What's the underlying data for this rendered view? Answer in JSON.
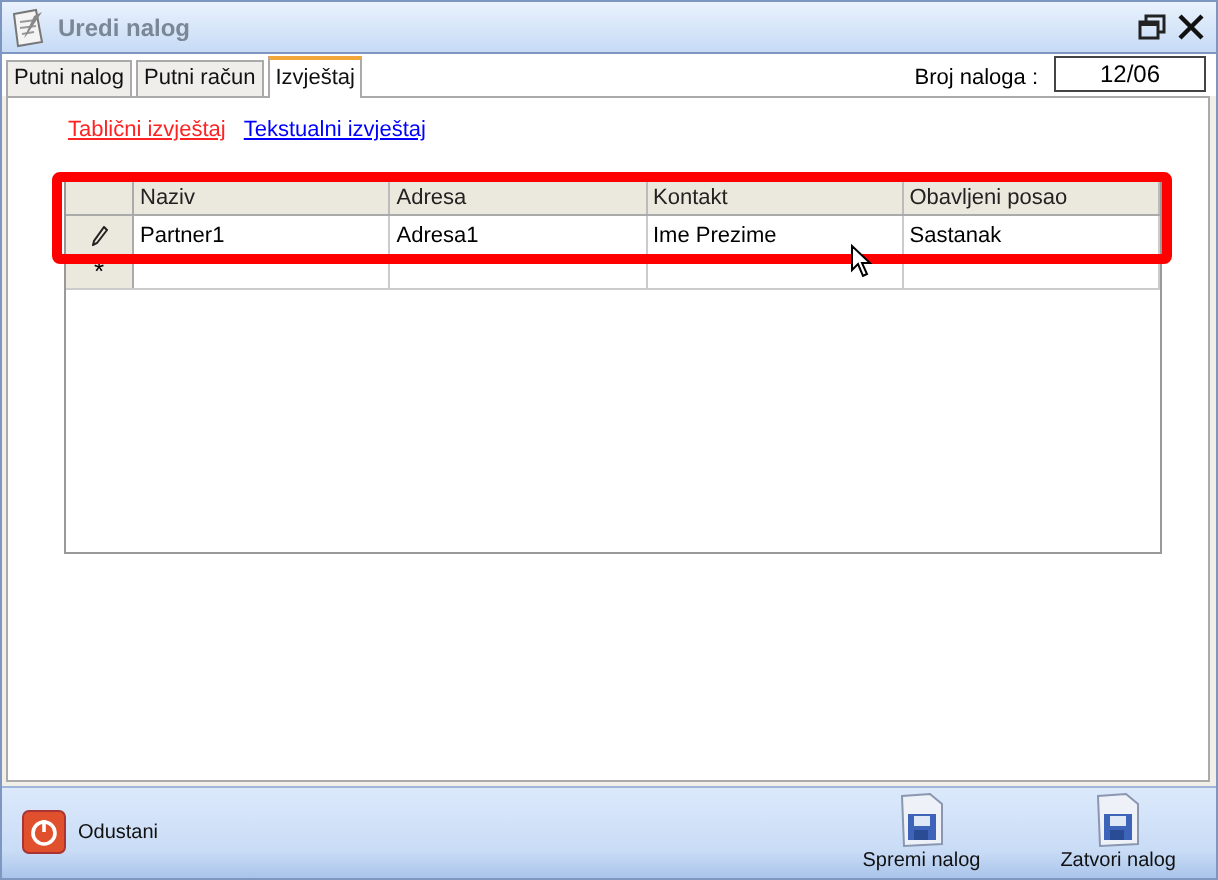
{
  "window": {
    "title": "Uredi nalog"
  },
  "tabs": [
    {
      "label": "Putni nalog",
      "selected": false
    },
    {
      "label": "Putni račun",
      "selected": false
    },
    {
      "label": "Izvještaj",
      "selected": true
    }
  ],
  "order_number": {
    "label": "Broj naloga :",
    "value": "12/06"
  },
  "report_links": [
    {
      "label": "Tablični izvještaj",
      "selected": true
    },
    {
      "label": "Tekstualni izvještaj",
      "selected": false
    }
  ],
  "table": {
    "columns": [
      "Naziv",
      "Adresa",
      "Kontakt",
      "Obavljeni posao"
    ],
    "rows": [
      {
        "kind": "edit",
        "cells": [
          "Partner1",
          "Adresa1",
          "Ime Prezime",
          "Sastanak"
        ]
      },
      {
        "kind": "new",
        "marker": "*"
      }
    ]
  },
  "footer": {
    "cancel": "Odustani",
    "buttons": [
      "Spremi nalog",
      "Zatvori nalog"
    ]
  }
}
